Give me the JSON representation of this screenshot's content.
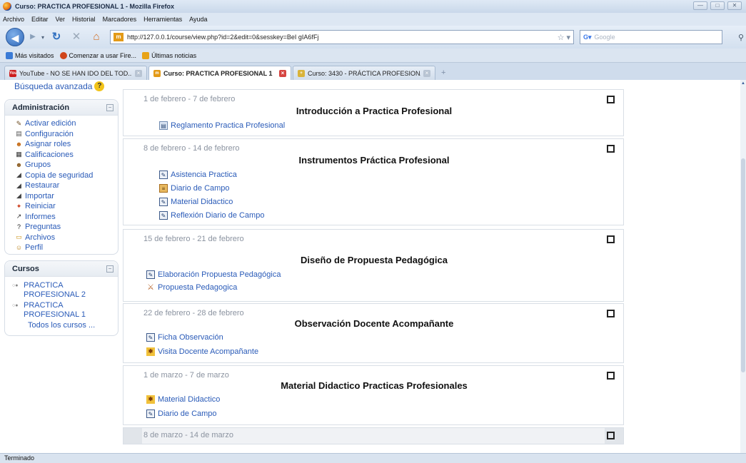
{
  "window": {
    "title": "Curso: PRACTICA PROFESIONAL 1 - Mozilla Firefox",
    "buttons": [
      "—",
      "□",
      "✕"
    ]
  },
  "menu": [
    "Archivo",
    "Editar",
    "Ver",
    "Historial",
    "Marcadores",
    "Herramientas",
    "Ayuda"
  ],
  "nav": {
    "url": "http://127.0.0.1/course/view.php?id=2&edit=0&sesskey=BeI gIA6fFj",
    "search_placeholder": "Google"
  },
  "bookmarks": [
    {
      "label": "Más visitados",
      "color": "#3b7bd6"
    },
    {
      "label": "Comenzar a usar Fire...",
      "color": "#d0451b"
    },
    {
      "label": "Últimas noticias",
      "color": "#e8a317"
    }
  ],
  "tabs": [
    {
      "label": "YouTube - NO SE HAN IDO DEL TOD...",
      "active": false,
      "icon_color": "#cc1e1e",
      "icon_text": "You"
    },
    {
      "label": "Curso: PRACTICA PROFESIONAL 1",
      "active": true,
      "icon_color": "#e39a17",
      "icon_text": "m"
    },
    {
      "label": "Curso: 3430 - PRÁCTICA PROFESIONA...",
      "active": false,
      "icon_color": "#d9b33a",
      "icon_text": "+"
    }
  ],
  "sidebar": {
    "advanced_search": "Búsqueda avanzada",
    "admin": {
      "title": "Administración",
      "items": [
        {
          "label": "Activar edición",
          "icon": "pencil-icon",
          "glyph": "✎",
          "color": "#6b4a1e"
        },
        {
          "label": "Configuración",
          "icon": "settings-icon",
          "glyph": "▤",
          "color": "#555"
        },
        {
          "label": "Asignar roles",
          "icon": "roles-icon",
          "glyph": "☻",
          "color": "#c56a13"
        },
        {
          "label": "Calificaciones",
          "icon": "grades-icon",
          "glyph": "▦",
          "color": "#333"
        },
        {
          "label": "Grupos",
          "icon": "groups-icon",
          "glyph": "☻",
          "color": "#8a5a1e"
        },
        {
          "label": "Copia de seguridad",
          "icon": "backup-icon",
          "glyph": "◢",
          "color": "#444"
        },
        {
          "label": "Restaurar",
          "icon": "restore-icon",
          "glyph": "◢",
          "color": "#444"
        },
        {
          "label": "Importar",
          "icon": "import-icon",
          "glyph": "◢",
          "color": "#444"
        },
        {
          "label": "Reiniciar",
          "icon": "reset-icon",
          "glyph": "✦",
          "color": "#cc3b1a"
        },
        {
          "label": "Informes",
          "icon": "reports-icon",
          "glyph": "↗",
          "color": "#333"
        },
        {
          "label": "Preguntas",
          "icon": "questions-icon",
          "glyph": "?",
          "color": "#222"
        },
        {
          "label": "Archivos",
          "icon": "files-icon",
          "glyph": "▭",
          "color": "#c98f12"
        },
        {
          "label": "Perfil",
          "icon": "profile-icon",
          "glyph": "☺",
          "color": "#b77c12"
        }
      ]
    },
    "courses": {
      "title": "Cursos",
      "items": [
        "PRACTICA PROFESIONAL 2",
        "PRACTICA PROFESIONAL 1"
      ],
      "all": "Todos los cursos ..."
    }
  },
  "sections": [
    {
      "date": "1 de febrero - 7 de febrero",
      "title": "Introducción a Practica Profesional",
      "activities": [
        {
          "label": "Reglamento Practica Profesional",
          "type": "resource"
        }
      ]
    },
    {
      "date": "8 de febrero - 14 de febrero",
      "title": "Instrumentos Práctica Profesional",
      "activities": [
        {
          "label": "Asistencia Practica",
          "type": "assignment"
        },
        {
          "label": "Diario de Campo",
          "type": "journal"
        },
        {
          "label": "Material Didactico",
          "type": "assignment"
        },
        {
          "label": "Reflexión Diario de Campo",
          "type": "assignment"
        }
      ]
    },
    {
      "date": "15 de febrero - 21 de febrero",
      "title": "Diseño de Propuesta Pedagógica",
      "activities": [
        {
          "label": "Elaboración Propuesta Pedagógica",
          "type": "assignment"
        },
        {
          "label": "Propuesta Pedagogica",
          "type": "forum"
        }
      ]
    },
    {
      "date": "22 de febrero - 28 de febrero",
      "title": "Observación Docente Acompañante",
      "activities": [
        {
          "label": "Ficha Observación",
          "type": "assignment"
        },
        {
          "label": "Visita Docente Acompañante",
          "type": "quiz"
        }
      ]
    },
    {
      "date": "1 de marzo - 7 de marzo",
      "title": "Material Didactico Practicas Profesionales",
      "activities": [
        {
          "label": "Material Didactico",
          "type": "quiz"
        },
        {
          "label": "Diario de Campo",
          "type": "assignment"
        }
      ]
    },
    {
      "date": "8 de marzo - 14 de marzo",
      "title": "",
      "activities": []
    }
  ],
  "status": "Terminado"
}
